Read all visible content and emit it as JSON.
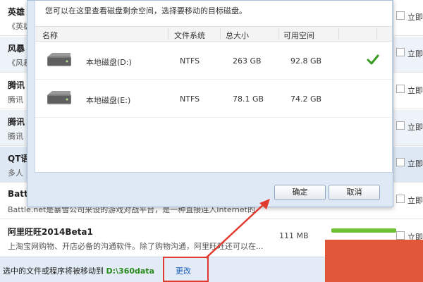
{
  "background_list": {
    "rows": [
      {
        "name": "英雄",
        "desc": "《英雄",
        "size": "",
        "action": "立即"
      },
      {
        "name": "风暴",
        "desc": "《风暴",
        "size": "",
        "action": "立即"
      },
      {
        "name": "腾讯",
        "desc": "腾讯",
        "size": "",
        "action": "立即"
      },
      {
        "name": "腾讯",
        "desc": "腾讯",
        "size": "",
        "action": "立即"
      },
      {
        "name": "QT语",
        "desc": "多人",
        "size": "",
        "action": "立即"
      },
      {
        "name": "Battl",
        "desc": "Battle.net是暴雪公司采设的游戏对战平台，是一种直接连入Internet的",
        "size": "",
        "action": "立即"
      },
      {
        "name": "阿里旺旺2014Beta1",
        "desc": "上淘宝网购物、开店必备的沟通软件。除了购物沟通，阿里旺旺还可以在...",
        "size": "111 MB",
        "action": "立即"
      }
    ]
  },
  "bottom_bar": {
    "prefix": "选中的文件或程序将被移动到",
    "path": "D:\\360data",
    "change_label": "更改"
  },
  "dialog": {
    "hint": "您可以在这里查看磁盘剩余空间，选择要移动的目标磁盘。",
    "columns": {
      "name": "名称",
      "fs": "文件系统",
      "total": "总大小",
      "free": "可用空间"
    },
    "disks": [
      {
        "name": "本地磁盘(D:)",
        "fs": "NTFS",
        "total": "263 GB",
        "free": "92.8 GB",
        "selected": true
      },
      {
        "name": "本地磁盘(E:)",
        "fs": "NTFS",
        "total": "78.1 GB",
        "free": "74.2 GB",
        "selected": false
      }
    ],
    "ok_label": "确定",
    "cancel_label": "取消"
  },
  "colors": {
    "highlight_red": "#e03b2e",
    "path_green": "#2b8a1f",
    "check_green": "#3a9a22",
    "orange_block": "#e0573a"
  },
  "icons": [
    "disk-icon",
    "checkmark-icon",
    "arrow-annotation"
  ]
}
